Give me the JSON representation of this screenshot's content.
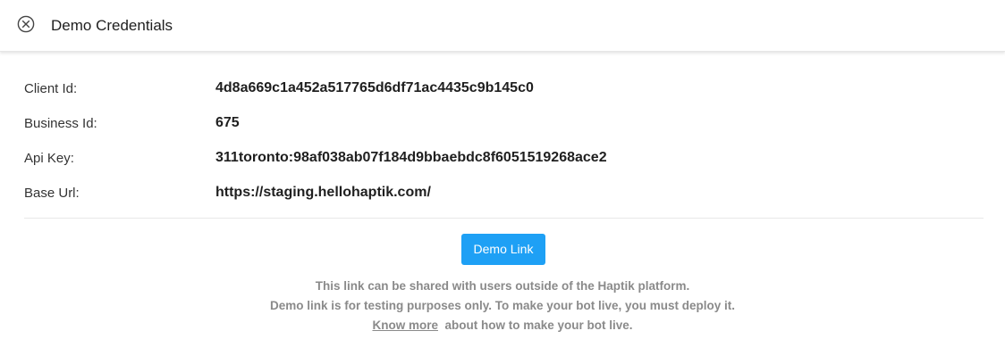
{
  "header": {
    "title": "Demo Credentials",
    "close_icon": "close-circle-icon"
  },
  "credentials": [
    {
      "label": "Client Id:",
      "value": "4d8a669c1a452a517765d6df71ac4435c9b145c0"
    },
    {
      "label": "Business Id:",
      "value": "675"
    },
    {
      "label": "Api Key:",
      "value": "311toronto:98af038ab07f184d9bbaebdc8f6051519268ace2"
    },
    {
      "label": "Base Url:",
      "value": "https://staging.hellohaptik.com/"
    }
  ],
  "demo_button": {
    "label": "Demo Link",
    "color": "#1ea0f5"
  },
  "info": {
    "line1": "This link can be shared with users outside of the Haptik platform.",
    "line2": "Demo link is for testing purposes only. To make your bot live, you must deploy it.",
    "know_more_link": "Know more",
    "line3_suffix": "about how to make your bot live."
  }
}
